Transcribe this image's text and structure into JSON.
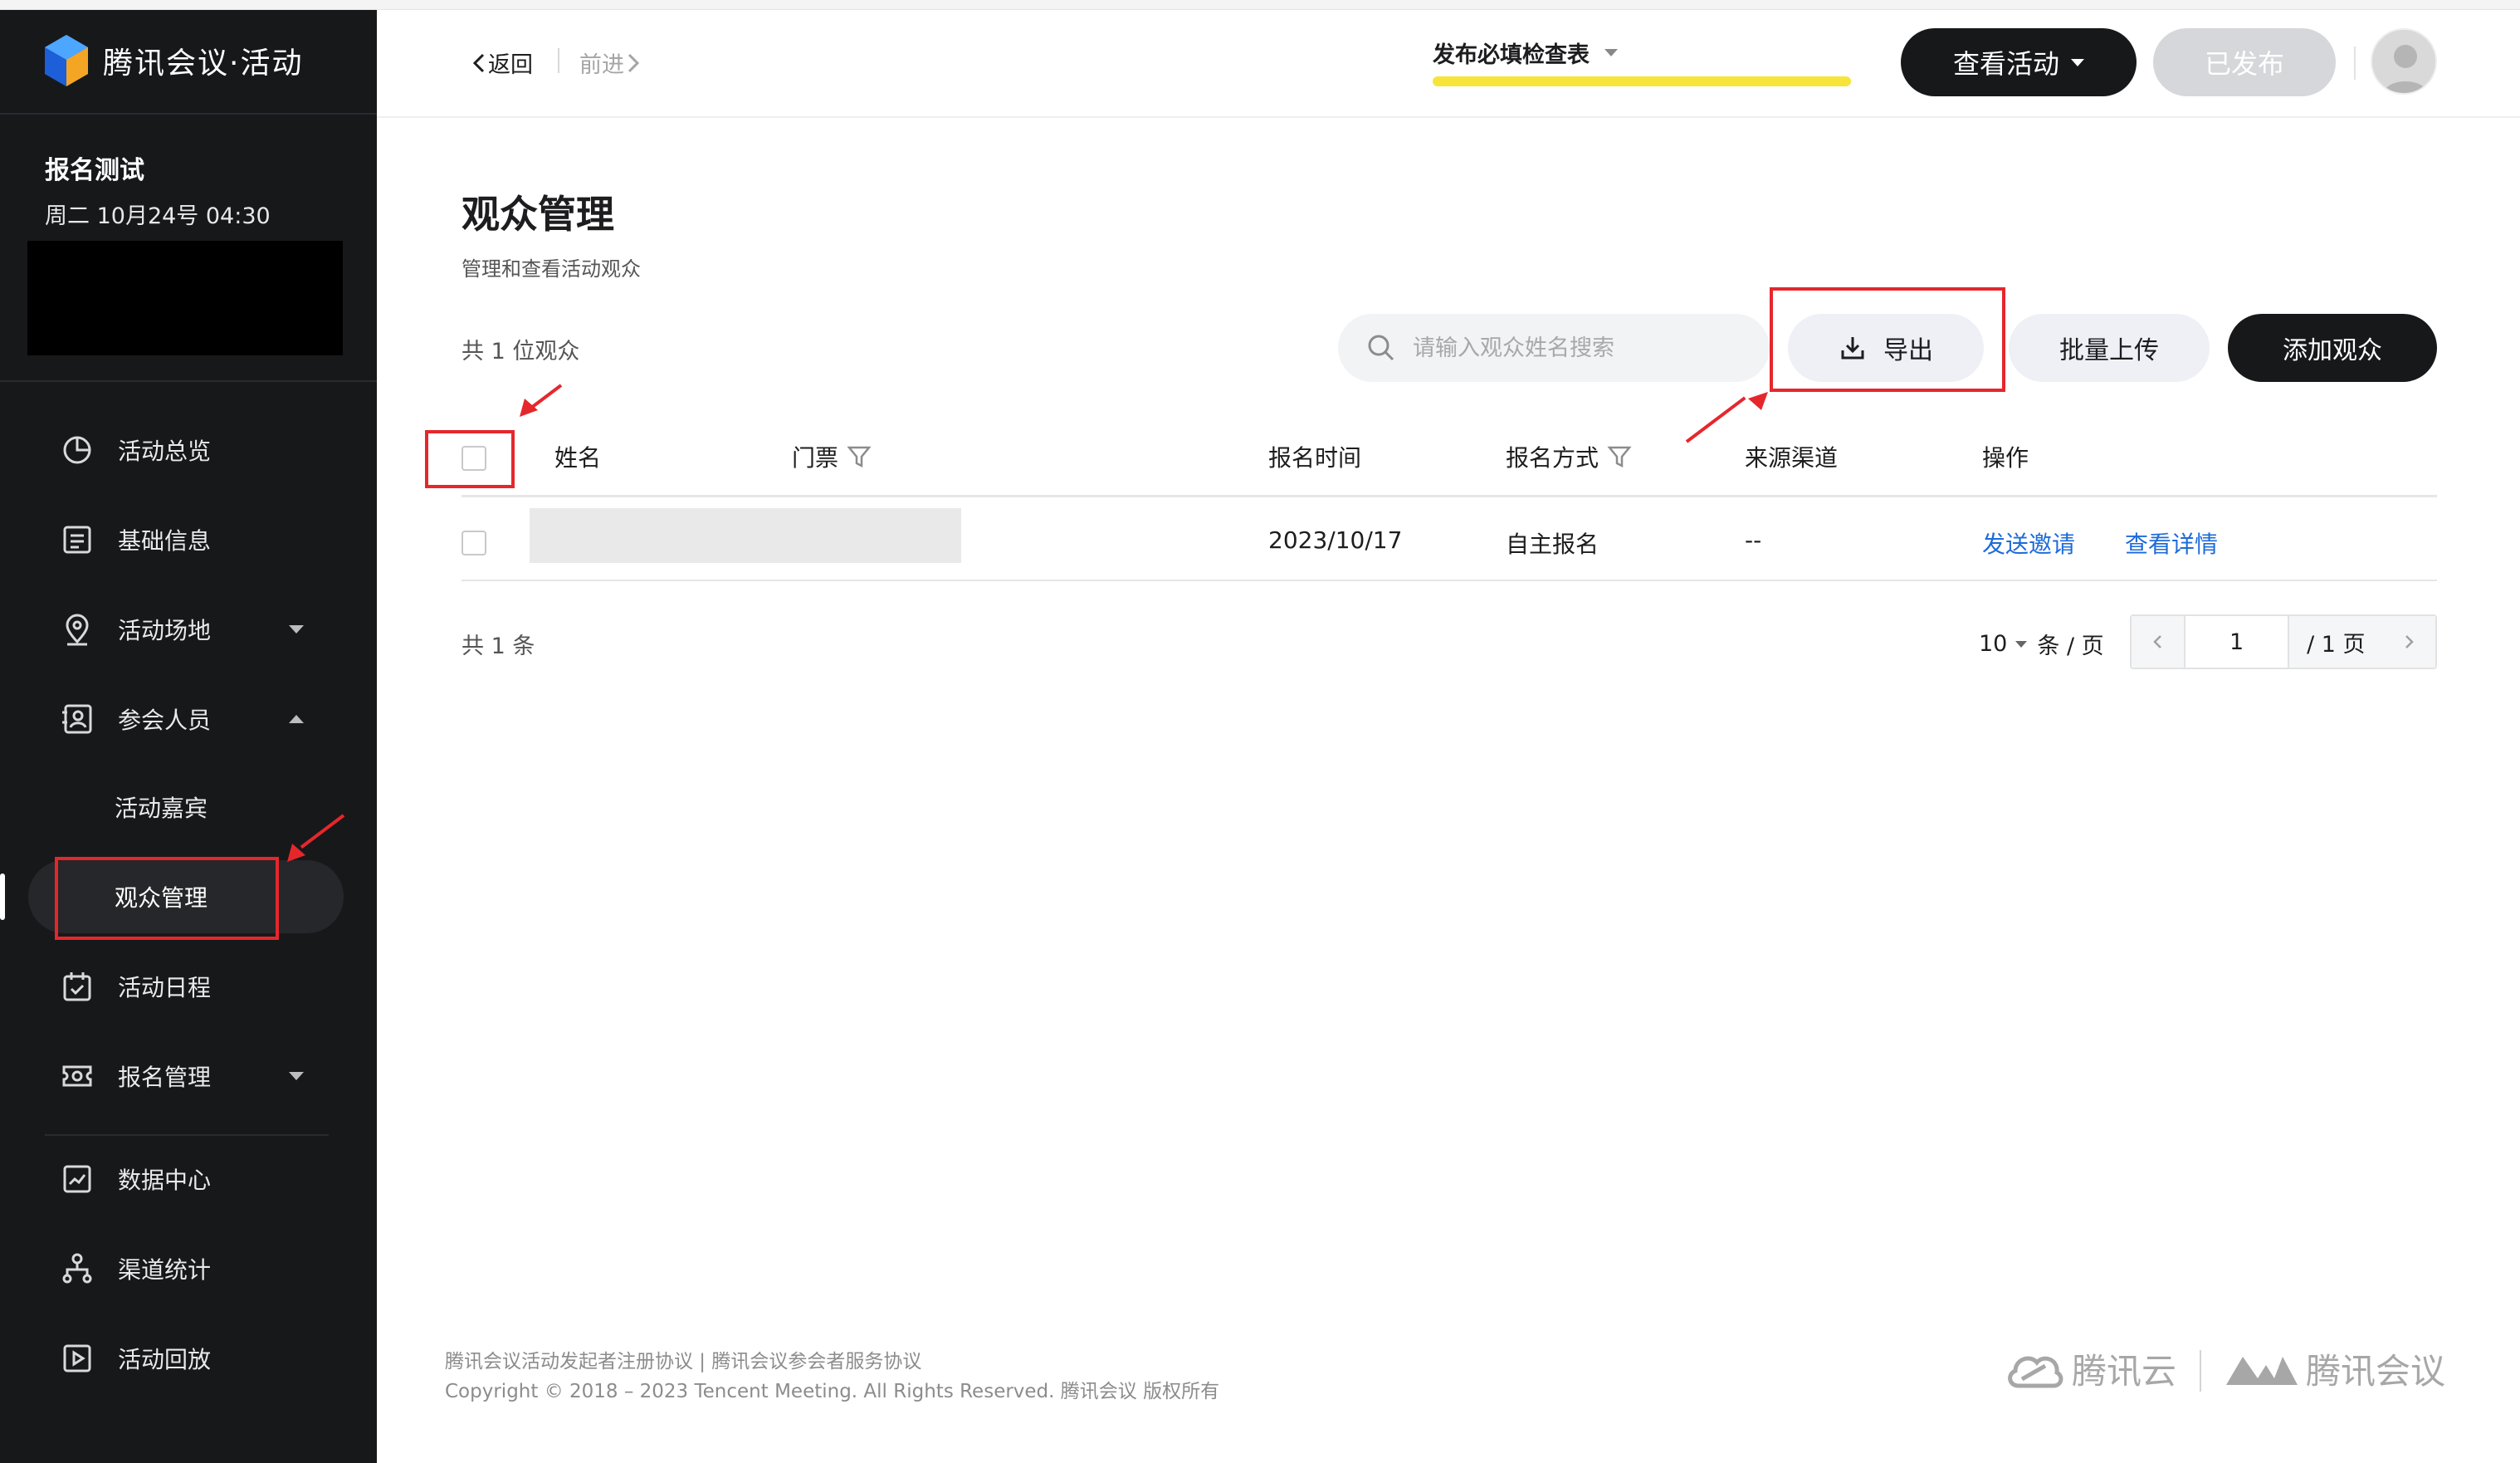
{
  "app": {
    "brand": "腾讯会议·活动"
  },
  "event": {
    "name": "报名测试",
    "time": "周二  10月24号  04:30"
  },
  "sidebar": {
    "items": [
      {
        "label": "活动总览",
        "icon": "pie-chart-icon"
      },
      {
        "label": "基础信息",
        "icon": "document-list-icon"
      },
      {
        "label": "活动场地",
        "icon": "location-pin-icon",
        "caret": "down"
      },
      {
        "label": "参会人员",
        "icon": "contact-card-icon",
        "caret": "up"
      },
      {
        "label": "活动嘉宾"
      },
      {
        "label": "观众管理",
        "active": true
      },
      {
        "label": "活动日程",
        "icon": "calendar-check-icon"
      },
      {
        "label": "报名管理",
        "icon": "ticket-icon",
        "caret": "down"
      },
      {
        "label": "数据中心",
        "icon": "chart-trend-icon"
      },
      {
        "label": "渠道统计",
        "icon": "hierarchy-icon"
      },
      {
        "label": "活动回放",
        "icon": "play-box-icon"
      }
    ]
  },
  "header": {
    "back": "返回",
    "forward": "前进",
    "checklist": "发布必填检查表",
    "view_event": "查看活动",
    "published": "已发布"
  },
  "main": {
    "title": "观众管理",
    "subtitle": "管理和查看活动观众",
    "count": "共 1 位观众",
    "search_placeholder": "请输入观众姓名搜索",
    "export": "导出",
    "batch_upload": "批量上传",
    "add_audience": "添加观众"
  },
  "table": {
    "columns": [
      "姓名",
      "门票",
      "报名时间",
      "报名方式",
      "来源渠道",
      "操作"
    ],
    "rows": [
      {
        "name": "",
        "ticket": "",
        "time": "2023/10/17",
        "method": "自主报名",
        "source": "--",
        "action1": "发送邀请",
        "action2": "查看详情"
      }
    ]
  },
  "pagination": {
    "total": "共  1  条",
    "page_size": "10",
    "page_size_unit": "条 / 页",
    "current": "1",
    "total_pages": "/ 1 页"
  },
  "footer": {
    "links": "腾讯会议活动发起者注册协议 | 腾讯会议参会者服务协议",
    "copyright": "Copyright © 2018 – 2023 Tencent Meeting. All Rights Reserved. 腾讯会议 版权所有",
    "brand_cloud": "腾讯云",
    "brand_meeting": "腾讯会议"
  },
  "colors": {
    "sidebar_bg": "#17181a",
    "accent_yellow": "#f7e43a",
    "link_blue": "#1e6bd8",
    "annotation_red": "#e5272c"
  }
}
